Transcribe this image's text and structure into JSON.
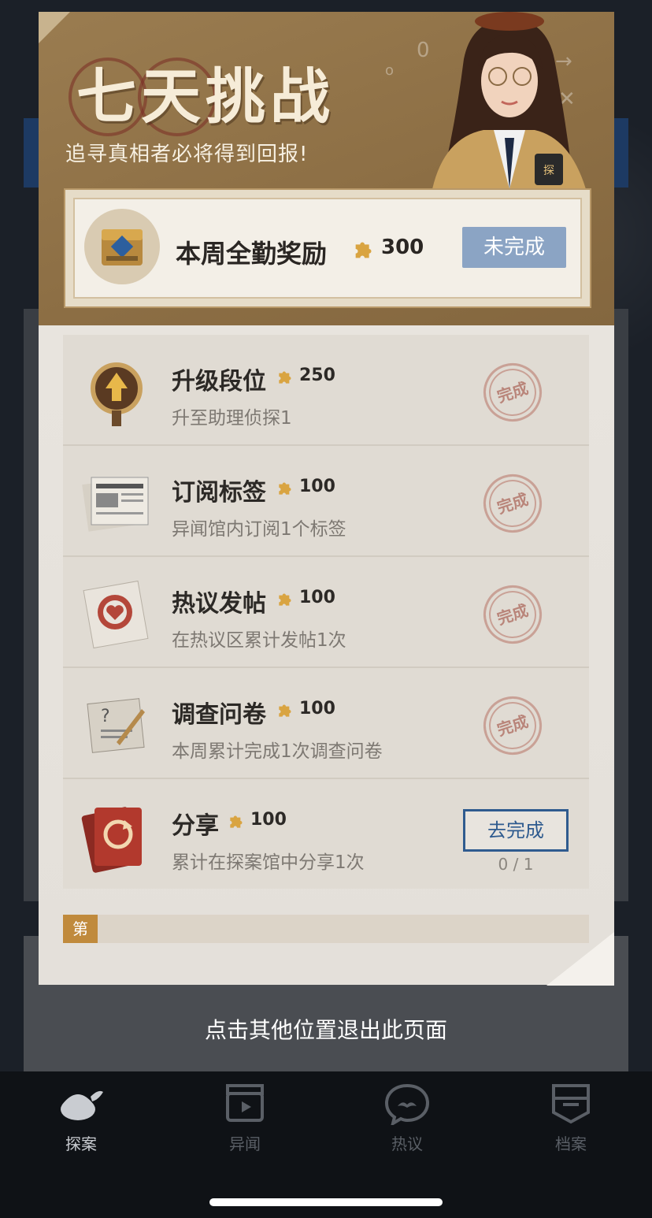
{
  "modal": {
    "title": "七天挑战",
    "subtitle": "追寻真相者必将得到回报!",
    "weekly_reward": {
      "label": "本周全勤奖励",
      "points": "300",
      "status": "未完成"
    },
    "tasks": [
      {
        "name": "升级段位",
        "points": "250",
        "desc": "升至助理侦探1",
        "status": "完成",
        "completed": true
      },
      {
        "name": "订阅标签",
        "points": "100",
        "desc": "异闻馆内订阅1个标签",
        "status": "完成",
        "completed": true
      },
      {
        "name": "热议发帖",
        "points": "100",
        "desc": "在热议区累计发帖1次",
        "status": "完成",
        "completed": true
      },
      {
        "name": "调查问卷",
        "points": "100",
        "desc": "本周累计完成1次调查问卷",
        "status": "完成",
        "completed": true
      },
      {
        "name": "分享",
        "points": "100",
        "desc": "累计在探案馆中分享1次",
        "action": "去完成",
        "progress": "0 / 1",
        "completed": false
      }
    ],
    "day_tag": "第"
  },
  "exit_hint": "点击其他位置退出此页面",
  "tabbar": {
    "tabs": [
      {
        "label": "探案",
        "active": true
      },
      {
        "label": "异闻",
        "active": false
      },
      {
        "label": "热议",
        "active": false
      },
      {
        "label": "档案",
        "active": false
      }
    ]
  },
  "colors": {
    "header_brown": "#8c6e44",
    "pending_blue": "#8ba4c4",
    "action_blue": "#2f5b8f",
    "stamp_red": "#b9857a",
    "day_tag": "#c08a3c"
  },
  "icons": [
    "treasure-chest-icon",
    "puzzle-piece-icon",
    "rank-badge-icon",
    "newspaper-icon",
    "heart-paper-icon",
    "questionnaire-icon",
    "share-card-icon",
    "detective-hat-icon",
    "clapperboard-icon",
    "chat-mustache-icon",
    "archive-badge-icon"
  ]
}
